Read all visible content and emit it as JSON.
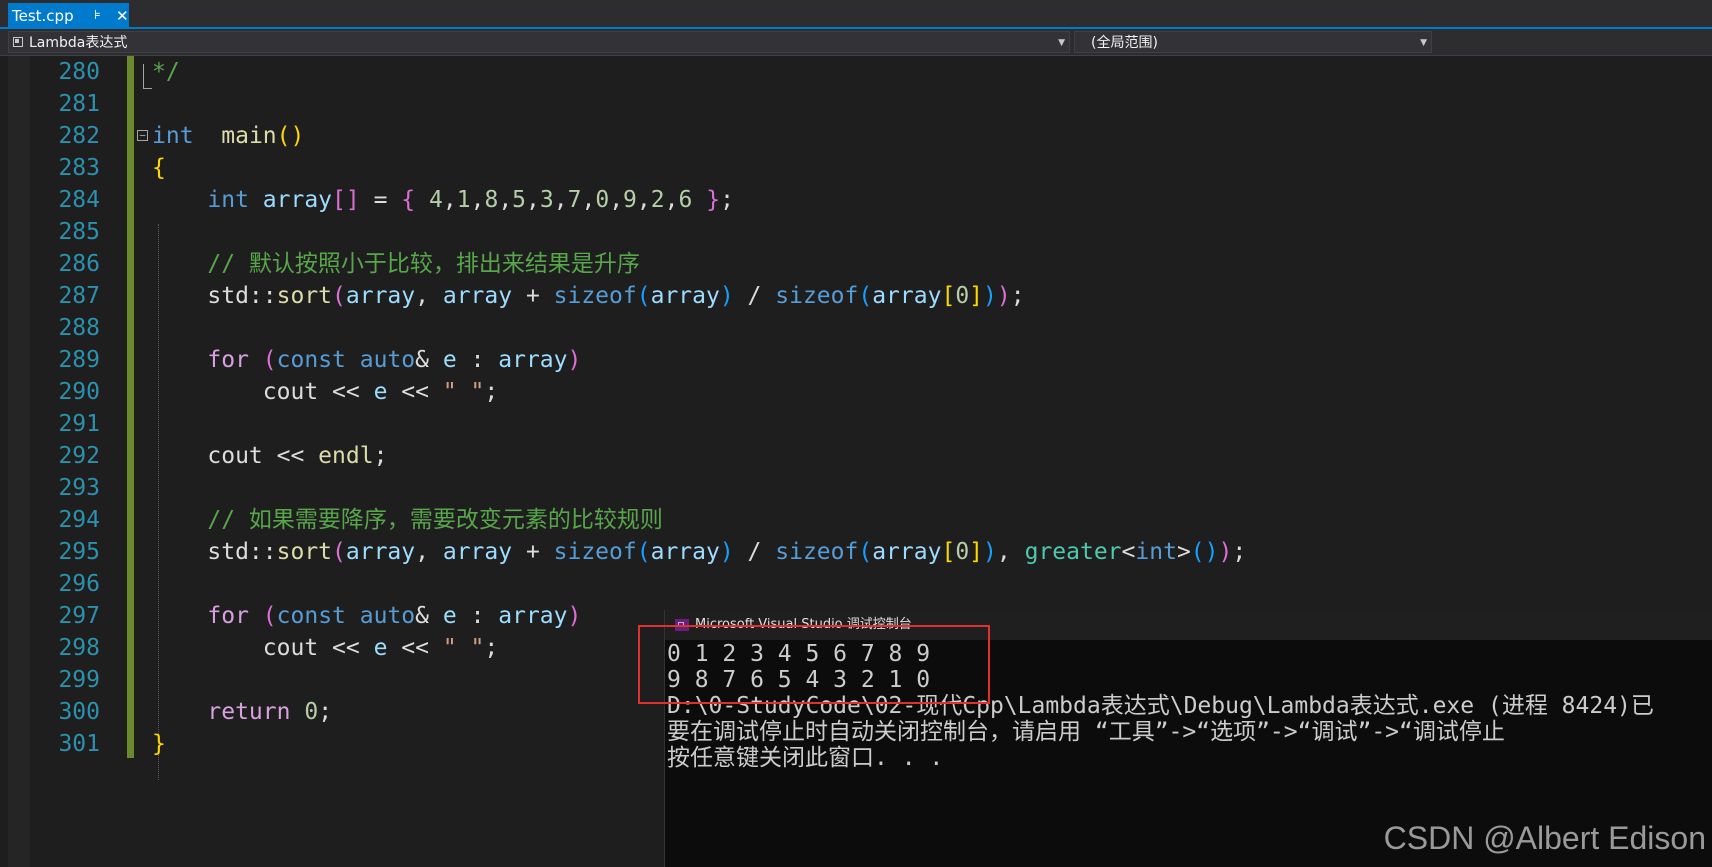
{
  "tab": {
    "title": "Test.cpp",
    "pin_glyph": "⊧",
    "close_glyph": "✕"
  },
  "navbar": {
    "scope": "Lambda表达式",
    "function": "(全局范围)"
  },
  "editor": {
    "lines": [
      {
        "n": "280",
        "tokens": [
          [
            "cm",
            "*/"
          ]
        ]
      },
      {
        "n": "281",
        "tokens": []
      },
      {
        "n": "282",
        "tokens": [
          [
            "kw",
            "int"
          ],
          [
            "",
            "  "
          ],
          [
            "fn",
            "main"
          ],
          [
            "b1",
            "()"
          ]
        ]
      },
      {
        "n": "283",
        "tokens": [
          [
            "b1",
            "{"
          ]
        ]
      },
      {
        "n": "284",
        "tokens": [
          [
            "",
            "    "
          ],
          [
            "kw",
            "int"
          ],
          [
            "",
            " "
          ],
          [
            "var",
            "array"
          ],
          [
            "b2",
            "[]"
          ],
          [
            "",
            " = "
          ],
          [
            "b2",
            "{"
          ],
          [
            "",
            " "
          ],
          [
            "num",
            "4"
          ],
          [
            "",
            ","
          ],
          [
            "num",
            "1"
          ],
          [
            "",
            ","
          ],
          [
            "num",
            "8"
          ],
          [
            "",
            ","
          ],
          [
            "num",
            "5"
          ],
          [
            "",
            ","
          ],
          [
            "num",
            "3"
          ],
          [
            "",
            ","
          ],
          [
            "num",
            "7"
          ],
          [
            "",
            ","
          ],
          [
            "num",
            "0"
          ],
          [
            "",
            ","
          ],
          [
            "num",
            "9"
          ],
          [
            "",
            ","
          ],
          [
            "num",
            "2"
          ],
          [
            "",
            ","
          ],
          [
            "num",
            "6"
          ],
          [
            "",
            " "
          ],
          [
            "b2",
            "}"
          ],
          [
            "",
            ";"
          ]
        ]
      },
      {
        "n": "285",
        "tokens": []
      },
      {
        "n": "286",
        "tokens": [
          [
            "",
            "    "
          ],
          [
            "cm",
            "// 默认按照小于比较，排出来结果是升序"
          ]
        ]
      },
      {
        "n": "287",
        "tokens": [
          [
            "",
            "    "
          ],
          [
            "",
            "std::"
          ],
          [
            "fn",
            "sort"
          ],
          [
            "b2",
            "("
          ],
          [
            "var",
            "array"
          ],
          [
            "",
            ", "
          ],
          [
            "var",
            "array"
          ],
          [
            "",
            " + "
          ],
          [
            "kw",
            "sizeof"
          ],
          [
            "b3",
            "("
          ],
          [
            "var",
            "array"
          ],
          [
            "b3",
            ")"
          ],
          [
            "",
            " / "
          ],
          [
            "kw",
            "sizeof"
          ],
          [
            "b3",
            "("
          ],
          [
            "var",
            "array"
          ],
          [
            "b1",
            "["
          ],
          [
            "num",
            "0"
          ],
          [
            "b1",
            "]"
          ],
          [
            "b3",
            ")"
          ],
          [
            "b2",
            ")"
          ],
          [
            "",
            ";"
          ]
        ]
      },
      {
        "n": "288",
        "tokens": []
      },
      {
        "n": "289",
        "tokens": [
          [
            "",
            "    "
          ],
          [
            "kwc",
            "for"
          ],
          [
            "",
            " "
          ],
          [
            "b2",
            "("
          ],
          [
            "kw",
            "const"
          ],
          [
            "",
            " "
          ],
          [
            "kw",
            "auto"
          ],
          [
            "",
            "& "
          ],
          [
            "var",
            "e"
          ],
          [
            "",
            " : "
          ],
          [
            "var",
            "array"
          ],
          [
            "b2",
            ")"
          ]
        ]
      },
      {
        "n": "290",
        "tokens": [
          [
            "",
            "        cout << "
          ],
          [
            "var",
            "e"
          ],
          [
            "",
            " << "
          ],
          [
            "str",
            "\" \""
          ],
          [
            "",
            ";"
          ]
        ]
      },
      {
        "n": "291",
        "tokens": []
      },
      {
        "n": "292",
        "tokens": [
          [
            "",
            "    cout << "
          ],
          [
            "fn",
            "endl"
          ],
          [
            "",
            ";"
          ]
        ]
      },
      {
        "n": "293",
        "tokens": []
      },
      {
        "n": "294",
        "tokens": [
          [
            "",
            "    "
          ],
          [
            "cm",
            "// 如果需要降序，需要改变元素的比较规则"
          ]
        ]
      },
      {
        "n": "295",
        "tokens": [
          [
            "",
            "    "
          ],
          [
            "",
            "std::"
          ],
          [
            "fn",
            "sort"
          ],
          [
            "b2",
            "("
          ],
          [
            "var",
            "array"
          ],
          [
            "",
            ", "
          ],
          [
            "var",
            "array"
          ],
          [
            "",
            " + "
          ],
          [
            "kw",
            "sizeof"
          ],
          [
            "b3",
            "("
          ],
          [
            "var",
            "array"
          ],
          [
            "b3",
            ")"
          ],
          [
            "",
            " / "
          ],
          [
            "kw",
            "sizeof"
          ],
          [
            "b3",
            "("
          ],
          [
            "var",
            "array"
          ],
          [
            "b1",
            "["
          ],
          [
            "num",
            "0"
          ],
          [
            "b1",
            "]"
          ],
          [
            "b3",
            ")"
          ],
          [
            "",
            ", "
          ],
          [
            "ty",
            "greater"
          ],
          [
            "",
            "<"
          ],
          [
            "kw",
            "int"
          ],
          [
            "",
            ">"
          ],
          [
            "b3",
            "("
          ],
          [
            "b3",
            ")"
          ],
          [
            "b2",
            ")"
          ],
          [
            "",
            ";"
          ]
        ]
      },
      {
        "n": "296",
        "tokens": []
      },
      {
        "n": "297",
        "tokens": [
          [
            "",
            "    "
          ],
          [
            "kwc",
            "for"
          ],
          [
            "",
            " "
          ],
          [
            "b2",
            "("
          ],
          [
            "kw",
            "const"
          ],
          [
            "",
            " "
          ],
          [
            "kw",
            "auto"
          ],
          [
            "",
            "& "
          ],
          [
            "var",
            "e"
          ],
          [
            "",
            " : "
          ],
          [
            "var",
            "array"
          ],
          [
            "b2",
            ")"
          ]
        ]
      },
      {
        "n": "298",
        "tokens": [
          [
            "",
            "        cout << "
          ],
          [
            "var",
            "e"
          ],
          [
            "",
            " << "
          ],
          [
            "str",
            "\" \""
          ],
          [
            "",
            ";"
          ]
        ]
      },
      {
        "n": "299",
        "tokens": []
      },
      {
        "n": "300",
        "tokens": [
          [
            "",
            "    "
          ],
          [
            "kwc",
            "return"
          ],
          [
            "",
            " "
          ],
          [
            "num",
            "0"
          ],
          [
            "",
            ";"
          ]
        ]
      },
      {
        "n": "301",
        "tokens": [
          [
            "b1",
            "}"
          ]
        ]
      }
    ]
  },
  "console": {
    "title": "Microsoft Visual Studio 调试控制台",
    "lines": [
      "0 1 2 3 4 5 6 7 8 9",
      "9 8 7 6 5 4 3 2 1 0",
      "D:\\0-StudyCode\\02-现代Cpp\\Lambda表达式\\Debug\\Lambda表达式.exe (进程 8424)已",
      "要在调试停止时自动关闭控制台，请启用 “工具”->“选项”->“调试”->“调试停止",
      "按任意键关闭此窗口. . ."
    ]
  },
  "watermark": "CSDN @Albert Edison"
}
